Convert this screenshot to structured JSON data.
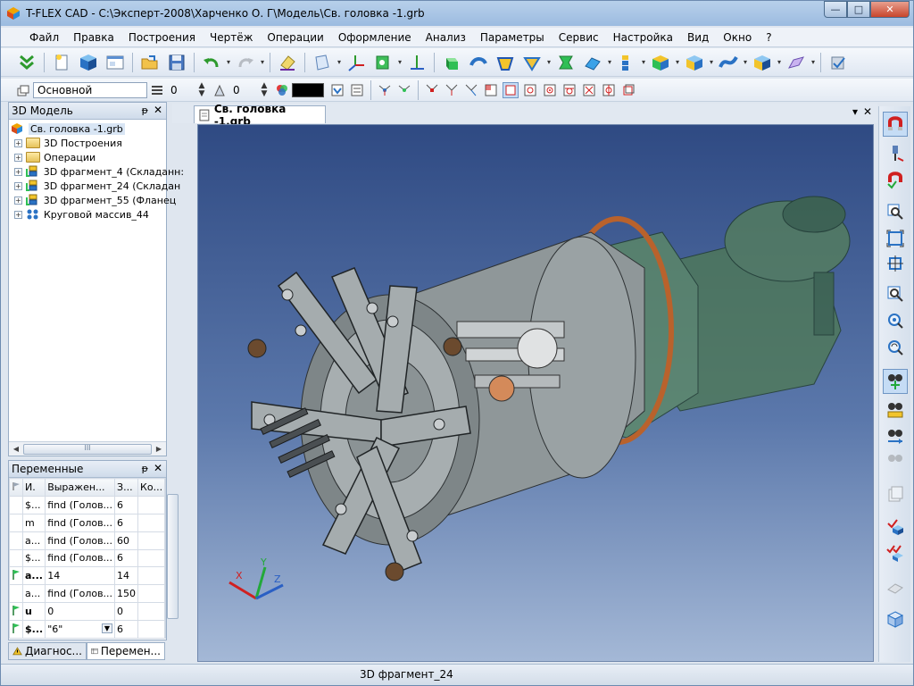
{
  "window": {
    "title": "T-FLEX CAD - C:\\Эксперт-2008\\Харченко О. Г\\Модель\\Св. головка -1.grb",
    "minimize": "—",
    "maximize": "□",
    "close": "✕"
  },
  "menu": {
    "items": [
      "Файл",
      "Правка",
      "Построения",
      "Чертёж",
      "Операции",
      "Оформление",
      "Анализ",
      "Параметры",
      "Сервис",
      "Настройка",
      "Вид",
      "Окно",
      "?"
    ]
  },
  "toolbar2": {
    "layer_combo": "Основной",
    "level_value": "0",
    "priority_value": "0"
  },
  "model_panel": {
    "title": "3D Модель",
    "pin": "ᵽ",
    "close": "✕",
    "root": "Св. головка -1.grb",
    "items": [
      {
        "label": "3D Построения",
        "icon": "folder-icon"
      },
      {
        "label": "Операции",
        "icon": "folder-icon"
      },
      {
        "label": "3D фрагмент_4 (Складанн:",
        "icon": "fragment-icon"
      },
      {
        "label": "3D фрагмент_24 (Складан",
        "icon": "fragment-icon"
      },
      {
        "label": "3D фрагмент_55 (Фланец",
        "icon": "fragment-icon"
      },
      {
        "label": "Круговой массив_44",
        "icon": "array-icon"
      }
    ],
    "scroll_mid": "III"
  },
  "vars_panel": {
    "title": "Переменные",
    "pin": "ᵽ",
    "close": "✕",
    "columns": [
      "И.",
      "Выражен...",
      "З...",
      "Ко..."
    ],
    "rows": [
      {
        "name": "$...",
        "expr": "find (Голов...",
        "value": "6",
        "flag": false
      },
      {
        "name": "m",
        "expr": "find (Голов...",
        "value": "6",
        "flag": false
      },
      {
        "name": "a...",
        "expr": "find (Голов...",
        "value": "60",
        "flag": false
      },
      {
        "name": "$...",
        "expr": "find (Голов...",
        "value": "6",
        "flag": false
      },
      {
        "name": "a...",
        "expr": "14",
        "value": "14",
        "flag": true
      },
      {
        "name": "a...",
        "expr": "find (Голов...",
        "value": "150",
        "flag": false
      },
      {
        "name": "u",
        "expr": "0",
        "value": "0",
        "flag": true
      },
      {
        "name": "$...",
        "expr": "\"6\"",
        "value": "6",
        "flag": true
      }
    ]
  },
  "bottom_tabs": {
    "diag": "Диагнос...",
    "vars": "Перемен..."
  },
  "document": {
    "tab": "Св. головка -1.grb",
    "axis_x": "X",
    "axis_y": "Y",
    "axis_z": "Z",
    "dropdown": "▾",
    "close": "✕"
  },
  "status": {
    "text": "3D фрагмент_24"
  },
  "colors": {
    "viewport_top": "#2f4a83",
    "viewport_bottom": "#a4b8d6",
    "assembly_grey": "#a7aeb0",
    "housing_green": "#4f7a55",
    "flange_copper": "#b9622c"
  }
}
